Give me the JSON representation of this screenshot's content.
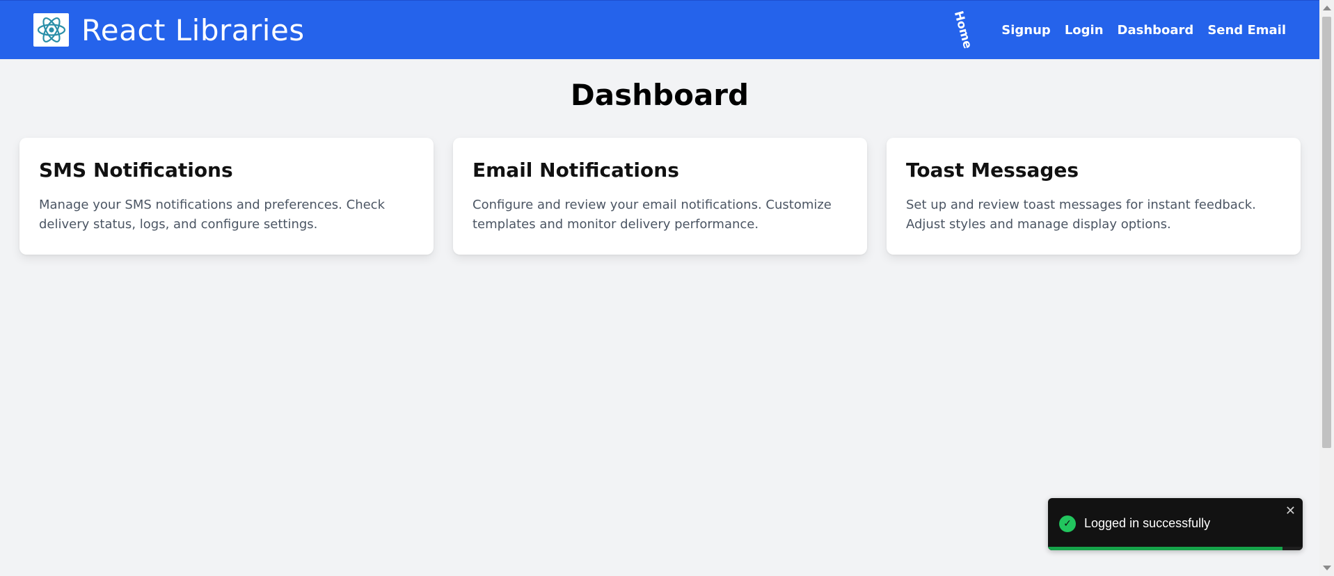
{
  "header": {
    "brand_title": "React Libraries",
    "logo_icon": "react-atom-icon",
    "nav": [
      {
        "label": "Home"
      },
      {
        "label": "Signup"
      },
      {
        "label": "Login"
      },
      {
        "label": "Dashboard"
      },
      {
        "label": "Send Email"
      }
    ]
  },
  "main": {
    "title": "Dashboard",
    "cards": [
      {
        "title": "SMS Notifications",
        "description": "Manage your SMS notifications and preferences. Check delivery status, logs, and configure settings."
      },
      {
        "title": "Email Notifications",
        "description": "Configure and review your email notifications. Customize templates and monitor delivery performance."
      },
      {
        "title": "Toast Messages",
        "description": "Set up and review toast messages for instant feedback. Adjust styles and manage display options."
      }
    ]
  },
  "toast": {
    "message": "Logged in successfully",
    "status_icon": "check-circle-icon",
    "close_glyph": "✕",
    "progress": 0.92
  },
  "colors": {
    "header_bg": "#2563eb",
    "page_bg": "#f2f3f5",
    "toast_bg": "#121212",
    "success": "#22c55e"
  }
}
